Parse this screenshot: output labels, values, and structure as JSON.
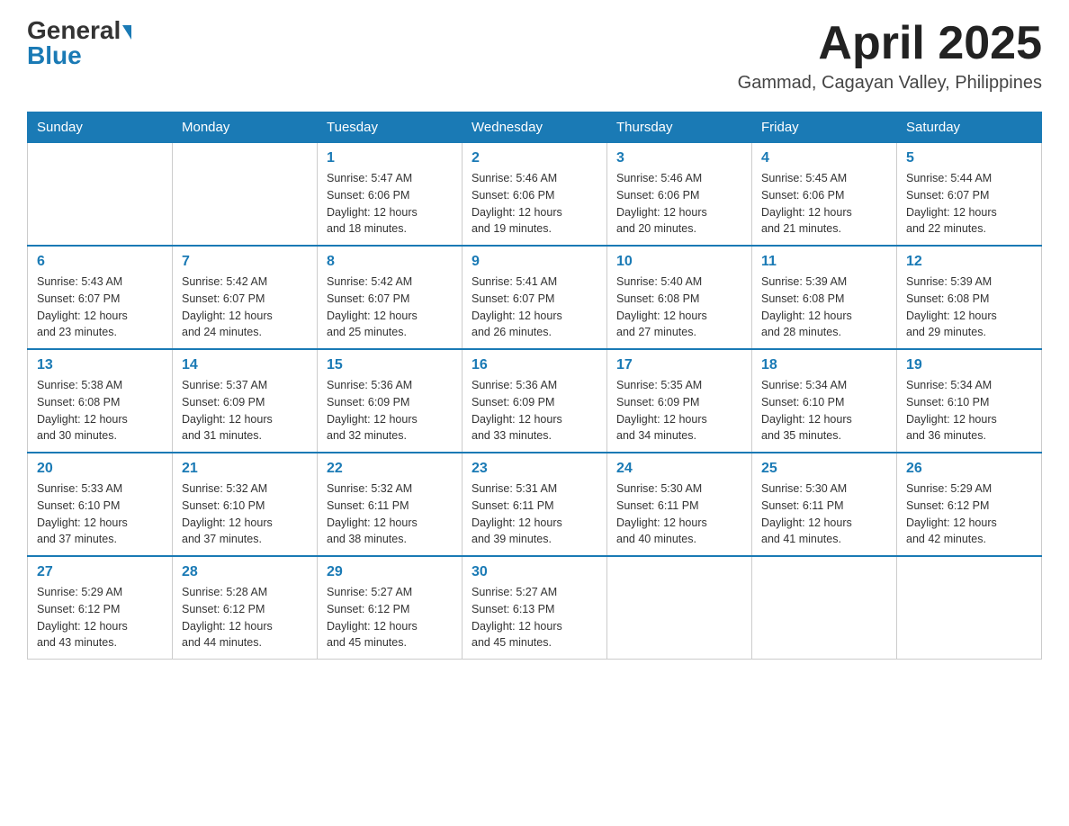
{
  "header": {
    "logo_general": "General",
    "logo_blue": "Blue",
    "month_title": "April 2025",
    "location": "Gammad, Cagayan Valley, Philippines"
  },
  "weekdays": [
    "Sunday",
    "Monday",
    "Tuesday",
    "Wednesday",
    "Thursday",
    "Friday",
    "Saturday"
  ],
  "weeks": [
    [
      {
        "day": "",
        "info": ""
      },
      {
        "day": "",
        "info": ""
      },
      {
        "day": "1",
        "info": "Sunrise: 5:47 AM\nSunset: 6:06 PM\nDaylight: 12 hours\nand 18 minutes."
      },
      {
        "day": "2",
        "info": "Sunrise: 5:46 AM\nSunset: 6:06 PM\nDaylight: 12 hours\nand 19 minutes."
      },
      {
        "day": "3",
        "info": "Sunrise: 5:46 AM\nSunset: 6:06 PM\nDaylight: 12 hours\nand 20 minutes."
      },
      {
        "day": "4",
        "info": "Sunrise: 5:45 AM\nSunset: 6:06 PM\nDaylight: 12 hours\nand 21 minutes."
      },
      {
        "day": "5",
        "info": "Sunrise: 5:44 AM\nSunset: 6:07 PM\nDaylight: 12 hours\nand 22 minutes."
      }
    ],
    [
      {
        "day": "6",
        "info": "Sunrise: 5:43 AM\nSunset: 6:07 PM\nDaylight: 12 hours\nand 23 minutes."
      },
      {
        "day": "7",
        "info": "Sunrise: 5:42 AM\nSunset: 6:07 PM\nDaylight: 12 hours\nand 24 minutes."
      },
      {
        "day": "8",
        "info": "Sunrise: 5:42 AM\nSunset: 6:07 PM\nDaylight: 12 hours\nand 25 minutes."
      },
      {
        "day": "9",
        "info": "Sunrise: 5:41 AM\nSunset: 6:07 PM\nDaylight: 12 hours\nand 26 minutes."
      },
      {
        "day": "10",
        "info": "Sunrise: 5:40 AM\nSunset: 6:08 PM\nDaylight: 12 hours\nand 27 minutes."
      },
      {
        "day": "11",
        "info": "Sunrise: 5:39 AM\nSunset: 6:08 PM\nDaylight: 12 hours\nand 28 minutes."
      },
      {
        "day": "12",
        "info": "Sunrise: 5:39 AM\nSunset: 6:08 PM\nDaylight: 12 hours\nand 29 minutes."
      }
    ],
    [
      {
        "day": "13",
        "info": "Sunrise: 5:38 AM\nSunset: 6:08 PM\nDaylight: 12 hours\nand 30 minutes."
      },
      {
        "day": "14",
        "info": "Sunrise: 5:37 AM\nSunset: 6:09 PM\nDaylight: 12 hours\nand 31 minutes."
      },
      {
        "day": "15",
        "info": "Sunrise: 5:36 AM\nSunset: 6:09 PM\nDaylight: 12 hours\nand 32 minutes."
      },
      {
        "day": "16",
        "info": "Sunrise: 5:36 AM\nSunset: 6:09 PM\nDaylight: 12 hours\nand 33 minutes."
      },
      {
        "day": "17",
        "info": "Sunrise: 5:35 AM\nSunset: 6:09 PM\nDaylight: 12 hours\nand 34 minutes."
      },
      {
        "day": "18",
        "info": "Sunrise: 5:34 AM\nSunset: 6:10 PM\nDaylight: 12 hours\nand 35 minutes."
      },
      {
        "day": "19",
        "info": "Sunrise: 5:34 AM\nSunset: 6:10 PM\nDaylight: 12 hours\nand 36 minutes."
      }
    ],
    [
      {
        "day": "20",
        "info": "Sunrise: 5:33 AM\nSunset: 6:10 PM\nDaylight: 12 hours\nand 37 minutes."
      },
      {
        "day": "21",
        "info": "Sunrise: 5:32 AM\nSunset: 6:10 PM\nDaylight: 12 hours\nand 37 minutes."
      },
      {
        "day": "22",
        "info": "Sunrise: 5:32 AM\nSunset: 6:11 PM\nDaylight: 12 hours\nand 38 minutes."
      },
      {
        "day": "23",
        "info": "Sunrise: 5:31 AM\nSunset: 6:11 PM\nDaylight: 12 hours\nand 39 minutes."
      },
      {
        "day": "24",
        "info": "Sunrise: 5:30 AM\nSunset: 6:11 PM\nDaylight: 12 hours\nand 40 minutes."
      },
      {
        "day": "25",
        "info": "Sunrise: 5:30 AM\nSunset: 6:11 PM\nDaylight: 12 hours\nand 41 minutes."
      },
      {
        "day": "26",
        "info": "Sunrise: 5:29 AM\nSunset: 6:12 PM\nDaylight: 12 hours\nand 42 minutes."
      }
    ],
    [
      {
        "day": "27",
        "info": "Sunrise: 5:29 AM\nSunset: 6:12 PM\nDaylight: 12 hours\nand 43 minutes."
      },
      {
        "day": "28",
        "info": "Sunrise: 5:28 AM\nSunset: 6:12 PM\nDaylight: 12 hours\nand 44 minutes."
      },
      {
        "day": "29",
        "info": "Sunrise: 5:27 AM\nSunset: 6:12 PM\nDaylight: 12 hours\nand 45 minutes."
      },
      {
        "day": "30",
        "info": "Sunrise: 5:27 AM\nSunset: 6:13 PM\nDaylight: 12 hours\nand 45 minutes."
      },
      {
        "day": "",
        "info": ""
      },
      {
        "day": "",
        "info": ""
      },
      {
        "day": "",
        "info": ""
      }
    ]
  ]
}
